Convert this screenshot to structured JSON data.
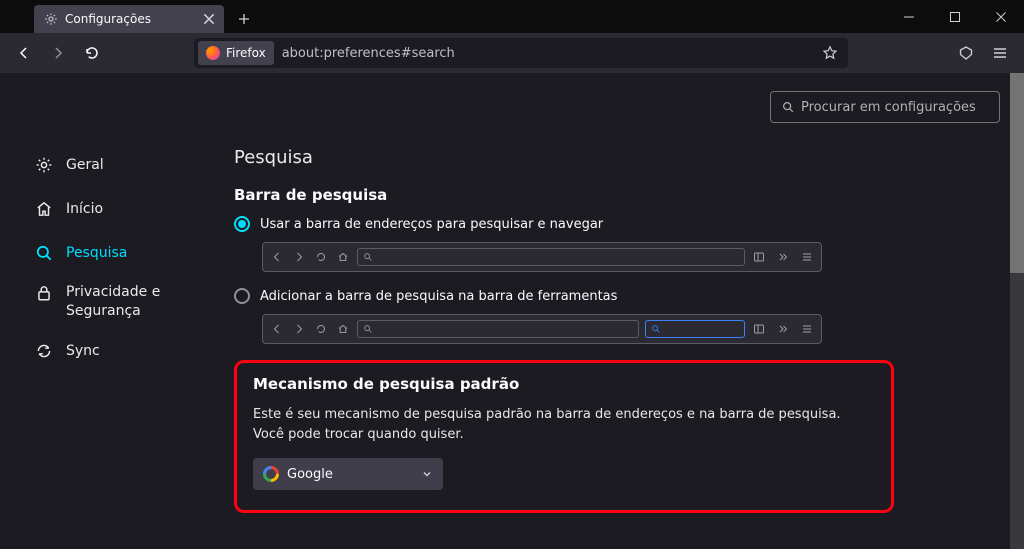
{
  "window": {
    "tab_title": "Configurações"
  },
  "navbar": {
    "identity_label": "Firefox",
    "url": "about:preferences#search"
  },
  "sidebar": {
    "items": [
      {
        "label": "Geral"
      },
      {
        "label": "Início"
      },
      {
        "label": "Pesquisa"
      },
      {
        "label": "Privacidade e\nSegurança"
      },
      {
        "label": "Sync"
      }
    ]
  },
  "main": {
    "search_placeholder": "Procurar em configurações",
    "title": "Pesquisa",
    "searchbar": {
      "title": "Barra de pesquisa",
      "opt1": "Usar a barra de endereços para pesquisar e navegar",
      "opt2": "Adicionar a barra de pesquisa na barra de ferramentas"
    },
    "default_engine": {
      "title": "Mecanismo de pesquisa padrão",
      "desc": "Este é seu mecanismo de pesquisa padrão na barra de endereços e na barra de pesquisa. Você pode trocar quando quiser.",
      "selected": "Google"
    }
  }
}
